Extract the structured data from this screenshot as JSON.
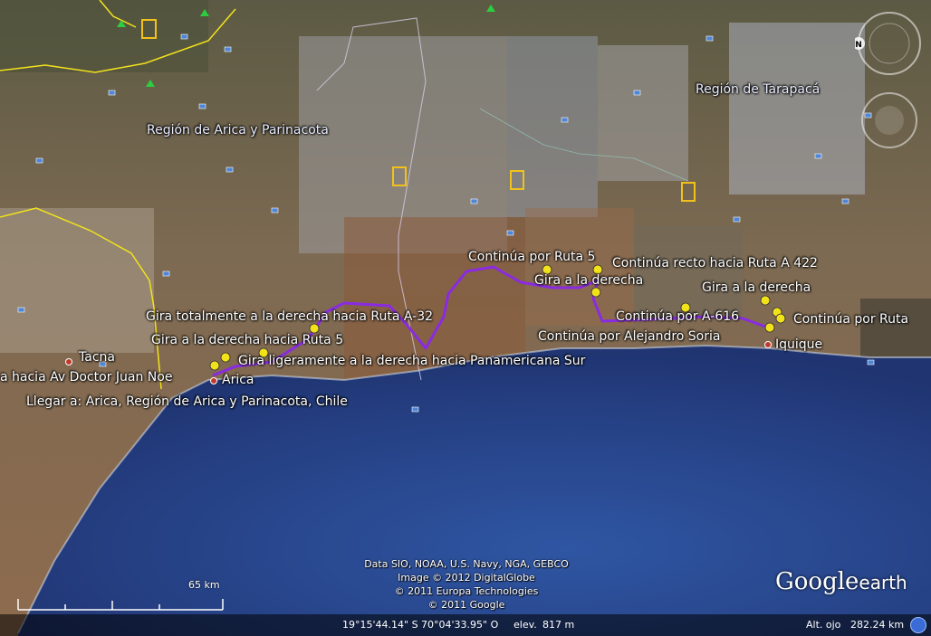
{
  "regions": {
    "arica": "Región de Arica y Parinacota",
    "tarapaca": "Región de Tarapacá"
  },
  "cities": {
    "tacna": "Tacna",
    "arica": "Arica",
    "iquique": "Iquique"
  },
  "route_directions": [
    "Continúa por Ruta 5",
    "Gira a la derecha",
    "Continúa recto hacia Ruta A 422",
    "Gira a la derecha",
    "Continúa por A-616",
    "Continúa por Ruta",
    "Continúa por Alejandro Soria",
    "Gira totalmente a la derecha hacia Ruta A-32",
    "Gira a la derecha hacia Ruta 5",
    "Gira ligeramente a la derecha hacia Panamericana Sur",
    "a hacia Av Doctor Juan Noe",
    "Llegar a: Arica, Región de Arica y Parinacota, Chile"
  ],
  "credits": [
    "Data SIO, NOAA, U.S. Navy, NGA, GEBCO",
    "Image © 2012 DigitalGlobe",
    "© 2011 Europa Technologies",
    "© 2011 Google"
  ],
  "brand": {
    "google": "Google",
    "earth": "earth"
  },
  "scale": {
    "label": "65 km"
  },
  "status": {
    "coords": "19°15'44.14\" S  70°04'33.95\" O",
    "elev_label": "elev.",
    "elev_value": "817 m",
    "eye_label": "Alt. ojo",
    "eye_value": "282.24 km"
  },
  "nav": {
    "north": "N"
  },
  "colors": {
    "route": "#8a2be2",
    "border": "#f2e21b",
    "ocean": "#2b4a8a",
    "land": "#8a7458"
  }
}
